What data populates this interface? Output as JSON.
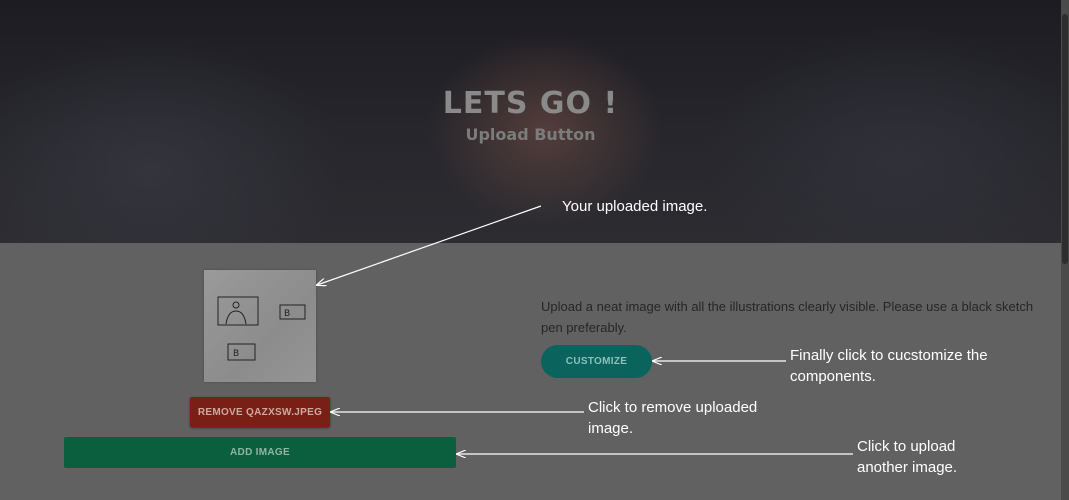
{
  "hero": {
    "title": "LETS GO !",
    "subtitle": "Upload Button"
  },
  "upload": {
    "remove_label": "REMOVE QAZXSW.JPEG",
    "add_label": "ADD IMAGE",
    "thumbnail_marks": [
      "B",
      "B"
    ]
  },
  "info": {
    "description": "Upload a neat image with all the illustrations clearly visible. Please use a black sketch pen preferably.",
    "customize_label": "CUSTOMIZE"
  },
  "annotations": {
    "uploaded_image": "Your uploaded image.",
    "customize": "Finally click to cucstomize the components.",
    "remove": "Click to remove uploaded image.",
    "add": "Click to upload another image."
  },
  "colors": {
    "remove_button": "#7a1f16",
    "add_button": "#0c5f3e",
    "customize_button": "#0a635c"
  }
}
